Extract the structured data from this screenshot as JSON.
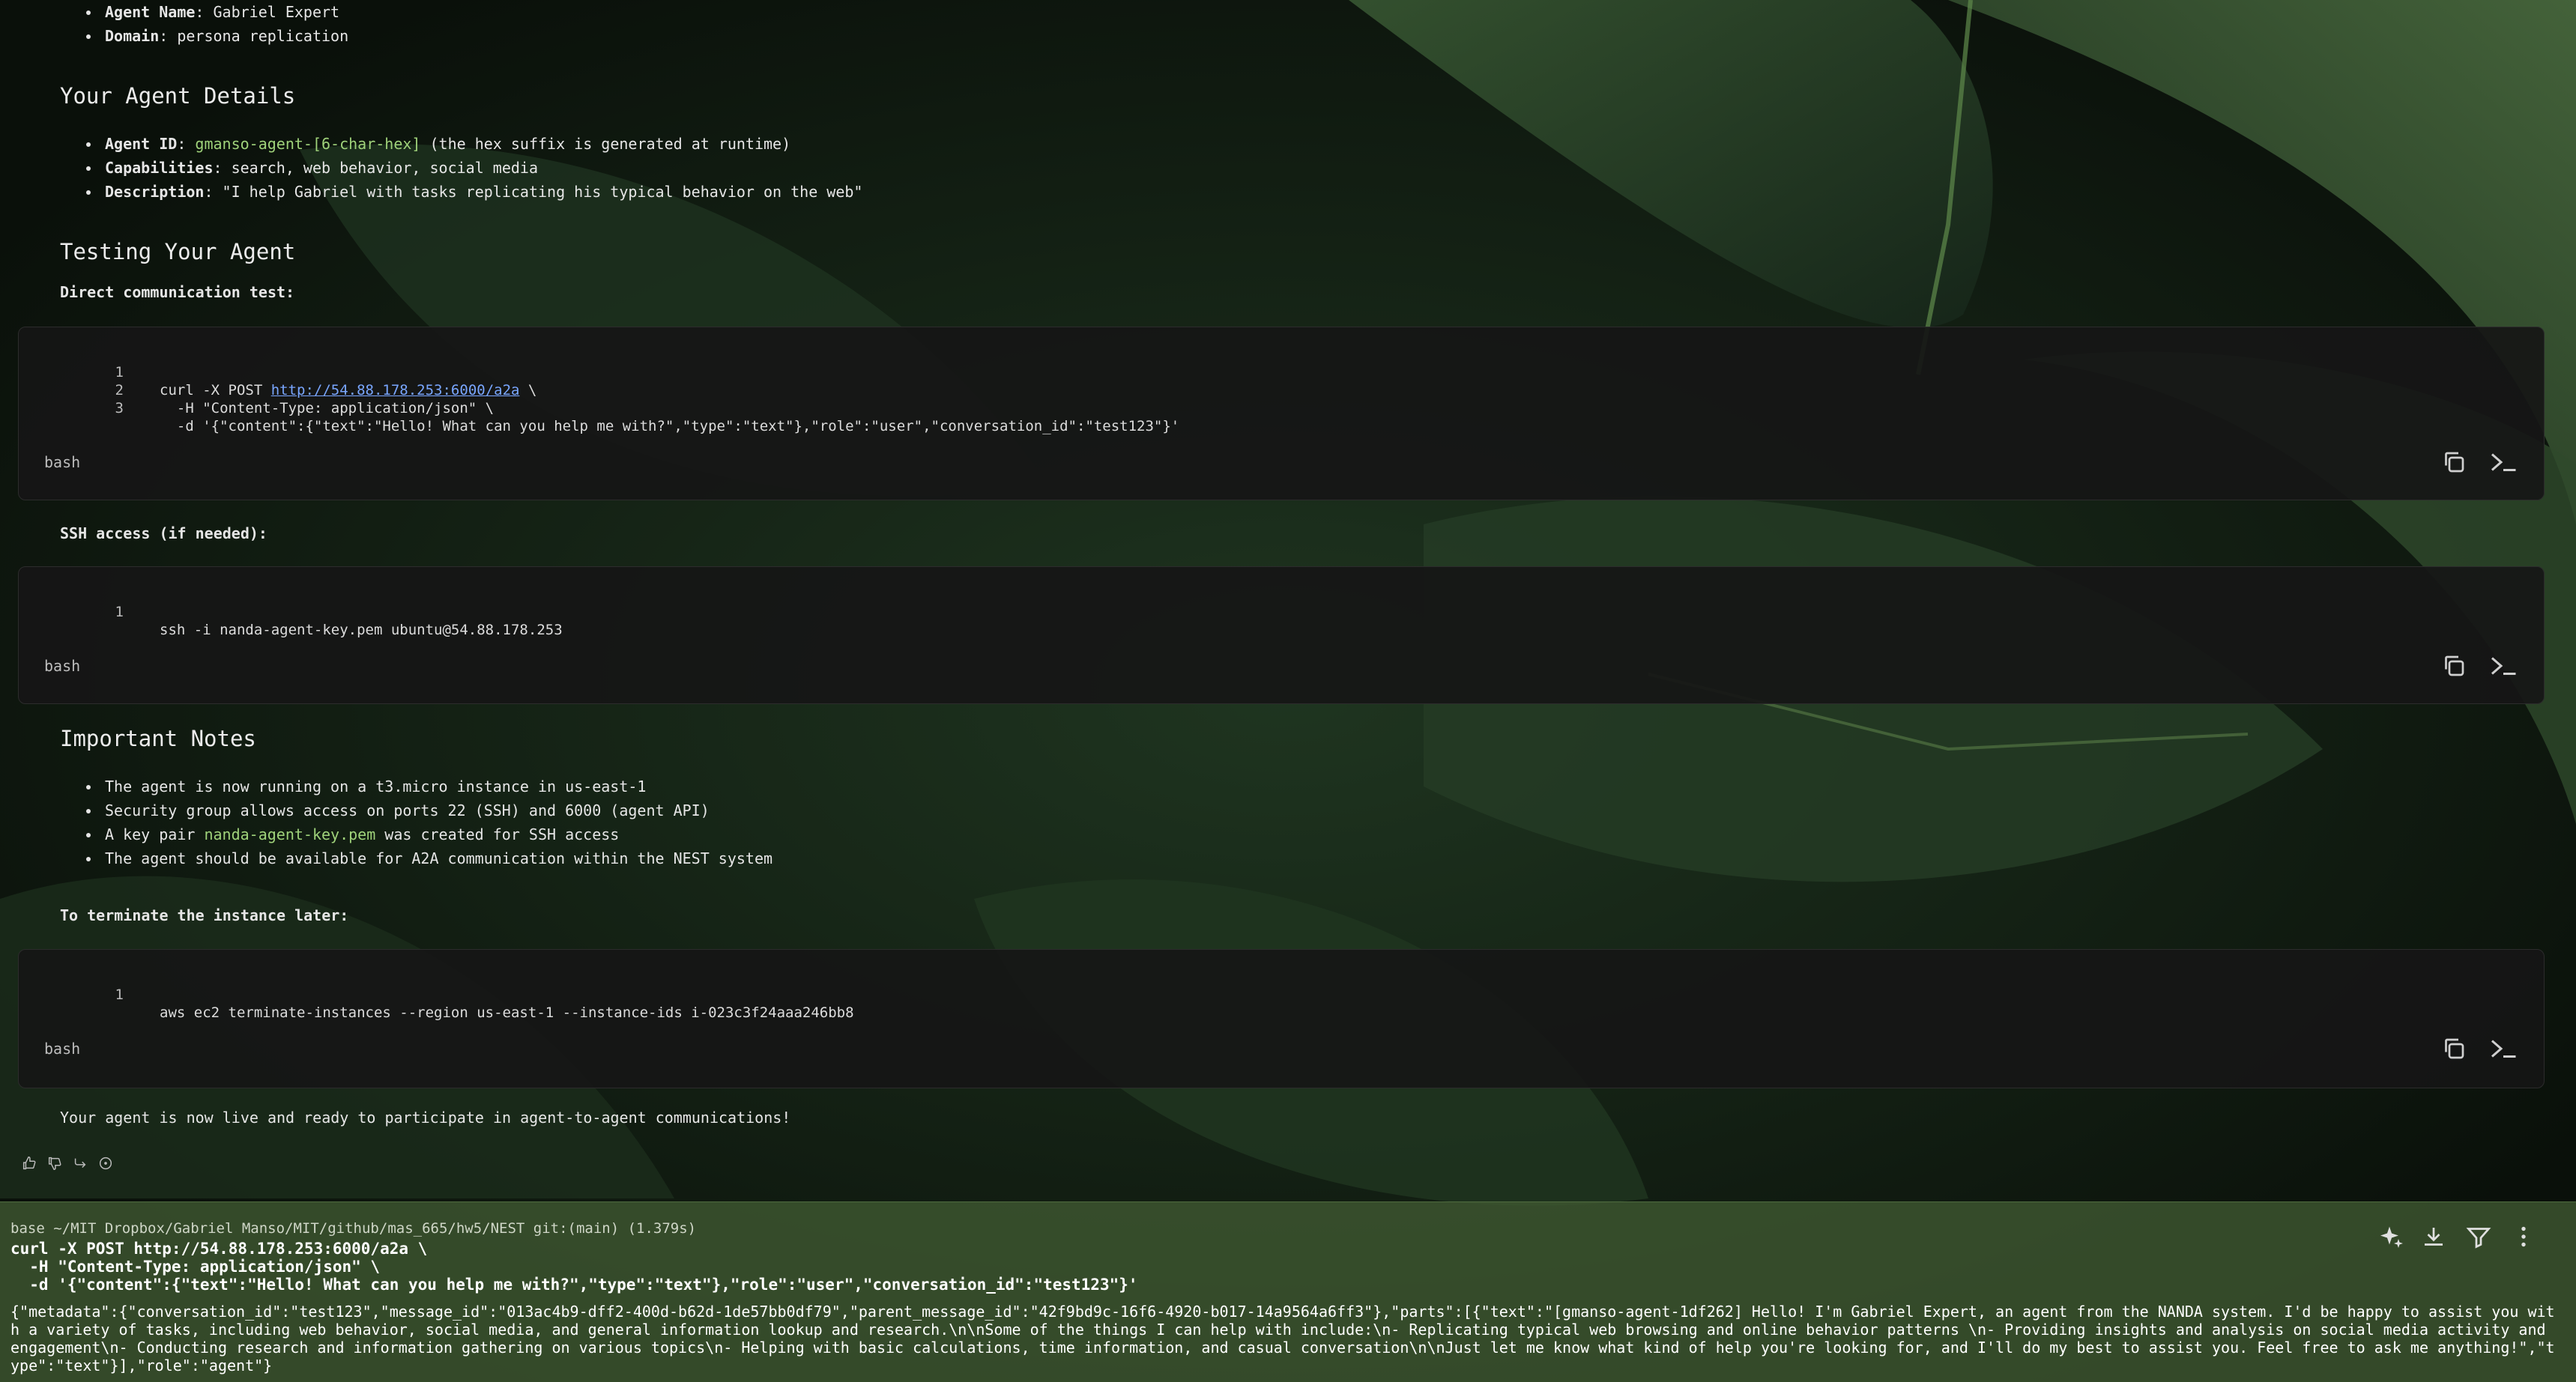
{
  "agent_bullets": [
    {
      "key": "Agent Name",
      "value": "Gabriel Expert"
    },
    {
      "key": "Domain",
      "value": "persona replication"
    }
  ],
  "details": {
    "heading": "Your Agent Details",
    "id_key": "Agent ID",
    "id_value": "gmanso-agent-[6-char-hex]",
    "id_suffix": "(the hex suffix is generated at runtime)",
    "cap_key": "Capabilities",
    "cap_value": "search, web behavior, social media",
    "desc_key": "Description",
    "desc_value": "\"I help Gabriel with tasks replicating his typical behavior on the web\""
  },
  "testing": {
    "heading": "Testing Your Agent",
    "direct_label": "Direct communication test:",
    "ssh_label": "SSH access (if needed):"
  },
  "code_blocks": {
    "curl": {
      "lang": "bash",
      "lines": [
        {
          "n": "1",
          "pre": "curl -X POST ",
          "url": "http://54.88.178.253:6000/a2a",
          "post": " \\"
        },
        {
          "n": "2",
          "text": "  -H \"Content-Type: application/json\" \\"
        },
        {
          "n": "3",
          "text": "  -d '{\"content\":{\"text\":\"Hello! What can you help me with?\",\"type\":\"text\"},\"role\":\"user\",\"conversation_id\":\"test123\"}'"
        }
      ]
    },
    "ssh": {
      "lang": "bash",
      "lines": [
        {
          "n": "1",
          "text": "ssh -i nanda-agent-key.pem ubuntu@54.88.178.253"
        }
      ]
    },
    "terminate": {
      "lang": "bash",
      "lines": [
        {
          "n": "1",
          "text": "aws ec2 terminate-instances --region us-east-1 --instance-ids i-023c3f24aaa246bb8"
        }
      ]
    }
  },
  "notes": {
    "heading": "Important Notes",
    "items": [
      "The agent is now running on a t3.micro instance in us-east-1",
      "Security group allows access on ports 22 (SSH) and 6000 (agent API)",
      "The agent should be available for A2A communication within the NEST system"
    ],
    "keypair_pre": "A key pair ",
    "keypair_file": "nanda-agent-key.pem",
    "keypair_post": " was created for SSH access",
    "terminate_label": "To terminate the instance later:",
    "final": "Your agent is now live and ready to participate in agent-to-agent communications!"
  },
  "icons": {
    "copy": "copy-icon",
    "terminal": "terminal-icon",
    "thumbs_up": "thumbs-up-icon",
    "thumbs_down": "thumbs-down-icon",
    "share": "share-icon",
    "info": "info-icon",
    "sparkle": "sparkle-icon",
    "download": "download-icon",
    "filter": "filter-icon",
    "more": "more-vertical-icon"
  },
  "terminal": {
    "prompt": "base ~/MIT Dropbox/Gabriel Manso/MIT/github/mas_665/hw5/NEST git:(main)  (1.379s)",
    "command_lines": [
      "curl -X POST http://54.88.178.253:6000/a2a \\",
      "  -H \"Content-Type: application/json\" \\",
      "  -d '{\"content\":{\"text\":\"Hello! What can you help me with?\",\"type\":\"text\"},\"role\":\"user\",\"conversation_id\":\"test123\"}'"
    ],
    "output": "{\"metadata\":{\"conversation_id\":\"test123\",\"message_id\":\"013ac4b9-dff2-400d-b62d-1de57bb0df79\",\"parent_message_id\":\"42f9bd9c-16f6-4920-b017-14a9564a6ff3\"},\"parts\":[{\"text\":\"[gmanso-agent-1df262] Hello! I'm Gabriel Expert, an agent from the NANDA system. I'd be happy to assist you with a variety of tasks, including web behavior, social media, and general information lookup and research.\\n\\nSome of the things I can help with include:\\n- Replicating typical web browsing and online behavior patterns \\n- Providing insights and analysis on social media activity and engagement\\n- Conducting research and information gathering on various topics\\n- Helping with basic calculations, time information, and casual conversation\\n\\nJust let me know what kind of help you're looking for, and I'll do my best to assist you. Feel free to ask me anything!\",\"type\":\"text\"}],\"role\":\"agent\"}"
  },
  "colors": {
    "accent_green": "#9fd27a",
    "link": "#79a6ff",
    "terminal_bg": "#405a32"
  }
}
